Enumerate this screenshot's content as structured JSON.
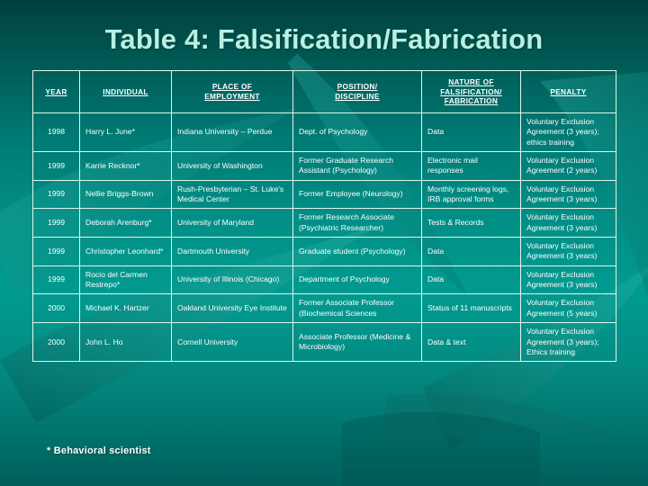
{
  "slide": {
    "title": "Table 4:  Falsification/Fabrication",
    "footnote": "* Behavioral scientist",
    "accent_color": "#b8f0e0",
    "background_color": "#019a90",
    "border_color": "#dff6ea",
    "text_color": "#ffffff"
  },
  "table": {
    "headers": [
      "YEAR",
      "INDIVIDUAL",
      "PLACE OF EMPLOYMENT",
      "POSITION/ DISCIPLINE",
      "NATURE OF FALSIFICATION/ FABRICATION",
      "PENALTY"
    ],
    "header_lines": [
      [
        "YEAR"
      ],
      [
        "INDIVIDUAL"
      ],
      [
        "PLACE OF",
        "EMPLOYMENT"
      ],
      [
        "POSITION/",
        "DISCIPLINE"
      ],
      [
        "NATURE OF",
        "FALSIFICATION/",
        "FABRICATION"
      ],
      [
        "PENALTY"
      ]
    ],
    "rows": [
      {
        "year": "1998",
        "individual": "Harry L. June*",
        "place": "Indiana University – Perdue",
        "position": "Dept. of Psychology",
        "nature": "Data",
        "penalty": "Voluntary Exclusion Agreement  (3 years); ethics training"
      },
      {
        "year": "1999",
        "individual": "Karrie Recknor*",
        "place": "University of Washington",
        "position": "Former Graduate Research Assistant (Psychology)",
        "nature": "Electronic mail responses",
        "penalty": "Voluntary Exclusion Agreement (2 years)"
      },
      {
        "year": "1999",
        "individual": "Nellie Briggs-Brown",
        "place": "Rush-Presbyterian – St. Luke's Medical Center",
        "position": "Former Employee (Neurology)",
        "nature": "Monthly screening logs, IRB approval forms",
        "penalty": "Voluntary Exclusion Agreement  (3 years)"
      },
      {
        "year": "1999",
        "individual": "Deborah Arenburg*",
        "place": "University of Maryland",
        "position": "Former Research Associate (Psychiatric Researcher)",
        "nature": "Tests & Records",
        "penalty": "Voluntary Exclusion Agreement (3 years)"
      },
      {
        "year": "1999",
        "individual": "Christopher Leonhard*",
        "place": "Dartmouth University",
        "position": "Graduate student (Psychology)",
        "nature": "Data",
        "penalty": "Voluntary Exclusion Agreement  (3 years)"
      },
      {
        "year": "1999",
        "individual": "Rocio del Carmen Restrepo*",
        "place": "University of Illinois (Chicago)",
        "position": "Department of Psychology",
        "nature": "Data",
        "penalty": "Voluntary Exclusion Agreement  (3 years)"
      },
      {
        "year": "2000",
        "individual": "Michael K. Hartzer",
        "place": "Oakland University Eye Institute",
        "position": "Former Associate Professor (Biochemical Sciences",
        "nature": "Status of 11 manuscripts",
        "penalty": "Voluntary Exclusion Agreement  (5 years)"
      },
      {
        "year": "2000",
        "individual": "John L. Ho",
        "place": "Cornell University",
        "position": "Associate Professor (Medicine & Microbiology)",
        "nature": "Data & text",
        "penalty": "Voluntary Exclusion Agreement  (3 years); Ethics training"
      }
    ]
  }
}
